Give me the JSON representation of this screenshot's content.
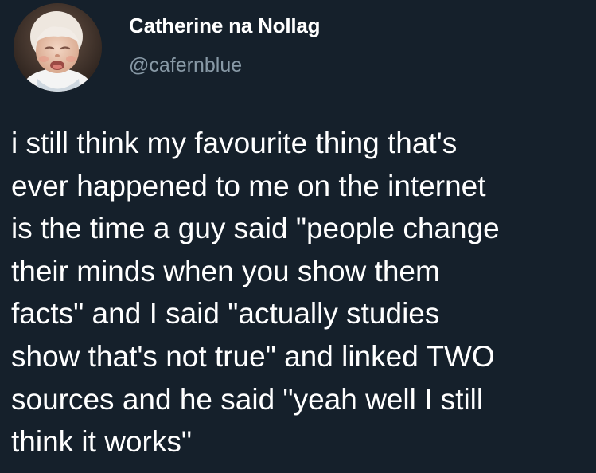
{
  "user": {
    "display_name": "Catherine na Nollag",
    "handle": "@cafernblue"
  },
  "tweet": {
    "lines": [
      "i still think my favourite thing that's",
      "ever happened to me on the internet",
      "is the time a guy said \"people change",
      "their minds when you show them",
      "facts\" and I said \"actually studies",
      "show that's not true\" and linked TWO",
      "sources and he said \"yeah well I still",
      "think it works\""
    ]
  },
  "colors": {
    "background": "#15202b",
    "name": "#ffffff",
    "handle": "#8899a6",
    "text": "#ffffff"
  }
}
